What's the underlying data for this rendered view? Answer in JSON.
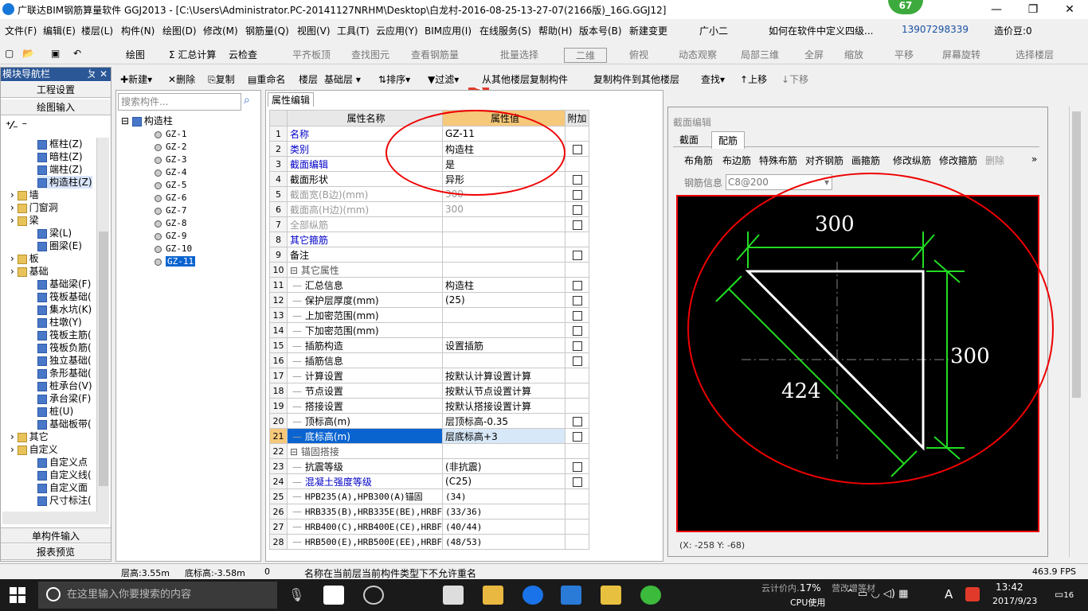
{
  "window": {
    "title": "广联达BIM钢筋算量软件 GGJ2013 - [C:\\Users\\Administrator.PC-20141127NRHM\\Desktop\\白龙村-2016-08-25-13-27-07(2166版)_16G.GGJ12]",
    "badge": "67",
    "min": "—",
    "max": "❐",
    "close": "✕"
  },
  "menu": [
    "文件(F)",
    "编辑(E)",
    "楼层(L)",
    "构件(N)",
    "绘图(D)",
    "修改(M)",
    "钢筋量(Q)",
    "视图(V)",
    "工具(T)",
    "云应用(Y)",
    "BIM应用(I)",
    "在线服务(S)",
    "帮助(H)",
    "版本号(B)",
    "新建变更",
    "广小二",
    "如何在软件中定义四级...",
    "13907298339",
    "造价豆:0"
  ],
  "toolbar1": [
    "绘图",
    "Σ 汇总计算",
    "云检查",
    "平齐板顶",
    "查找图元",
    "查看钢筋量",
    "批量选择",
    "二维",
    "俯视",
    "动态观察",
    "局部三维",
    "全屏",
    "缩放",
    "平移",
    "屏幕旋转",
    "选择楼层"
  ],
  "toolbar2": {
    "new": "新建",
    "del": "删除",
    "copy": "复制",
    "rename": "重命名",
    "floor_label": "楼层",
    "floor_value": "基础层",
    "sort": "排序",
    "filter": "过滤",
    "copy_from": "从其他楼层复制构件",
    "copy_to": "复制构件到其他楼层",
    "find": "查找",
    "up": "上移",
    "down": "下移"
  },
  "nav": {
    "title": "模块导航栏",
    "pin": "ㄆ ✕",
    "btn_project": "工程设置",
    "btn_draw": "绘图输入",
    "btn_single": "单构件输入",
    "btn_report": "报表预览",
    "items": [
      {
        "t": "框柱(Z)",
        "l": 2
      },
      {
        "t": "暗柱(Z)",
        "l": 2
      },
      {
        "t": "端柱(Z)",
        "l": 2
      },
      {
        "t": "构造柱(Z)",
        "l": 2
      },
      {
        "t": "墙",
        "l": 1
      },
      {
        "t": "门窗洞",
        "l": 1
      },
      {
        "t": "梁",
        "l": 1
      },
      {
        "t": "梁(L)",
        "l": 2
      },
      {
        "t": "圈梁(E)",
        "l": 2
      },
      {
        "t": "板",
        "l": 1
      },
      {
        "t": "基础",
        "l": 1
      },
      {
        "t": "基础梁(F)",
        "l": 2
      },
      {
        "t": "筏板基础(",
        "l": 2
      },
      {
        "t": "集水坑(K)",
        "l": 2
      },
      {
        "t": "柱墩(Y)",
        "l": 2
      },
      {
        "t": "筏板主筋(",
        "l": 2
      },
      {
        "t": "筏板负筋(",
        "l": 2
      },
      {
        "t": "独立基础(",
        "l": 2
      },
      {
        "t": "条形基础(",
        "l": 2
      },
      {
        "t": "桩承台(V)",
        "l": 2
      },
      {
        "t": "承台梁(F)",
        "l": 2
      },
      {
        "t": "桩(U)",
        "l": 2
      },
      {
        "t": "基础板带(",
        "l": 2
      },
      {
        "t": "其它",
        "l": 1
      },
      {
        "t": "自定义",
        "l": 1
      },
      {
        "t": "自定义点",
        "l": 2
      },
      {
        "t": "自定义线(",
        "l": 2
      },
      {
        "t": "自定义面",
        "l": 2
      },
      {
        "t": "尺寸标注(",
        "l": 2
      }
    ]
  },
  "tree": {
    "search_placeholder": "搜索构件...",
    "root": "构造柱",
    "items": [
      "GZ-1",
      "GZ-2",
      "GZ-3",
      "GZ-4",
      "GZ-5",
      "GZ-6",
      "GZ-7",
      "GZ-8",
      "GZ-9",
      "GZ-10",
      "GZ-11"
    ],
    "selected": "GZ-11"
  },
  "props": {
    "tab": "属性编辑",
    "headers": [
      "属性名称",
      "属性值",
      "附加"
    ],
    "rows": [
      {
        "n": "1",
        "name": "名称",
        "val": "GZ-11",
        "blue": true,
        "cb": false
      },
      {
        "n": "2",
        "name": "类别",
        "val": "构造柱",
        "blue": true,
        "cb": true
      },
      {
        "n": "3",
        "name": "截面编辑",
        "val": "是",
        "blue": true,
        "cb": false
      },
      {
        "n": "4",
        "name": "截面形状",
        "val": "异形",
        "blue": false,
        "cb": true
      },
      {
        "n": "5",
        "name": "截面宽(B边)(mm)",
        "val": "300",
        "gray": true,
        "cb": true
      },
      {
        "n": "6",
        "name": "截面高(H边)(mm)",
        "val": "300",
        "gray": true,
        "cb": true
      },
      {
        "n": "7",
        "name": "全部纵筋",
        "val": "",
        "gray": true,
        "cb": true
      },
      {
        "n": "8",
        "name": "其它箍筋",
        "val": "",
        "blue": true,
        "cb": false
      },
      {
        "n": "9",
        "name": "备注",
        "val": "",
        "cb": true
      },
      {
        "n": "10",
        "name": "⊟ 其它属性",
        "val": "",
        "group": true,
        "cb": false
      },
      {
        "n": "11",
        "name": "汇总信息",
        "val": "构造柱",
        "sub": true,
        "cb": true
      },
      {
        "n": "12",
        "name": "保护层厚度(mm)",
        "val": "(25)",
        "sub": true,
        "cb": true
      },
      {
        "n": "13",
        "name": "上加密范围(mm)",
        "val": "",
        "sub": true,
        "cb": true
      },
      {
        "n": "14",
        "name": "下加密范围(mm)",
        "val": "",
        "sub": true,
        "cb": true
      },
      {
        "n": "15",
        "name": "插筋构造",
        "val": "设置插筋",
        "sub": true,
        "cb": true
      },
      {
        "n": "16",
        "name": "插筋信息",
        "val": "",
        "sub": true,
        "cb": true
      },
      {
        "n": "17",
        "name": "计算设置",
        "val": "按默认计算设置计算",
        "sub": true,
        "cb": false
      },
      {
        "n": "18",
        "name": "节点设置",
        "val": "按默认节点设置计算",
        "sub": true,
        "cb": false
      },
      {
        "n": "19",
        "name": "搭接设置",
        "val": "按默认搭接设置计算",
        "sub": true,
        "cb": false
      },
      {
        "n": "20",
        "name": "顶标高(m)",
        "val": "层顶标高-0.35",
        "sub": true,
        "cb": true
      },
      {
        "n": "21",
        "name": "底标高(m)",
        "val": "层底标高+3",
        "sub": true,
        "cb": true,
        "sel": true
      },
      {
        "n": "22",
        "name": "⊟ 锚固搭接",
        "val": "",
        "group": true,
        "cb": false
      },
      {
        "n": "23",
        "name": "抗震等级",
        "val": "(非抗震)",
        "sub": true,
        "cb": true
      },
      {
        "n": "24",
        "name": "混凝土强度等级",
        "val": "(C25)",
        "sub": true,
        "blue": true,
        "cb": true
      },
      {
        "n": "25",
        "name": "HPB235(A),HPB300(A)锚固",
        "val": "(34)",
        "sub": true,
        "mono": true,
        "cb": false
      },
      {
        "n": "26",
        "name": "HRB335(B),HRB335E(BE),HRBF",
        "val": "(33/36)",
        "sub": true,
        "mono": true,
        "cb": false
      },
      {
        "n": "27",
        "name": "HRB400(C),HRB400E(CE),HRBF",
        "val": "(40/44)",
        "sub": true,
        "mono": true,
        "cb": false
      },
      {
        "n": "28",
        "name": "HRB500(E),HRB500E(EE),HRBF",
        "val": "(48/53)",
        "sub": true,
        "mono": true,
        "cb": false
      }
    ]
  },
  "section": {
    "title": "截面编辑",
    "tab1": "截面",
    "tab2": "配筋",
    "tools": [
      "布角筋",
      "布边筋",
      "特殊布筋",
      "对齐钢筋",
      "画箍筋",
      "修改纵筋",
      "修改箍筋",
      "删除"
    ],
    "rebar_label": "钢筋信息",
    "rebar_value": "C8@200",
    "dim_top": "300",
    "dim_right": "300",
    "dim_diag": "424",
    "coord": "(X: -258 Y: -68)"
  },
  "status": {
    "floor_h": "层高:3.55m",
    "bottom_h": "底标高:-3.58m",
    "zero": "0",
    "msg": "名称在当前层当前构件类型下不允许重名",
    "fps": "463.9 FPS"
  },
  "taskbar": {
    "search": "在这里输入你要搜索的内容",
    "cloud": "云计价内…",
    "change": "营改增等材",
    "cpu": "17%",
    "cpu_label": "CPU使用",
    "time": "13:42",
    "date": "2017/9/23",
    "notify": "16",
    "ime": "A"
  }
}
